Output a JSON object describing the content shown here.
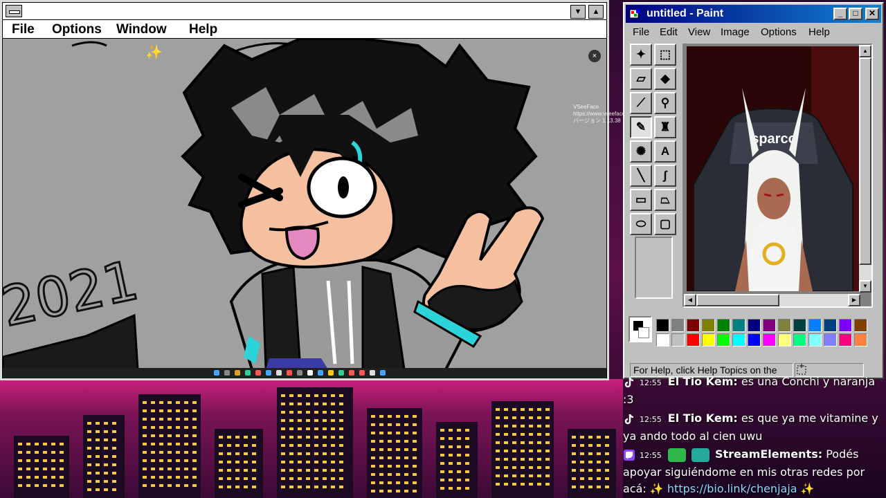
{
  "draw_app": {
    "menus": [
      "File",
      "Options",
      "Window",
      "Help"
    ],
    "drawing_text": "2021",
    "overlay": {
      "close_label": "×",
      "vseeface_lines": [
        "VSeeFace",
        "https://www.vseeface",
        "バージョン 1.13.38"
      ]
    }
  },
  "paint": {
    "title": "untitled - Paint",
    "menus": [
      "File",
      "Edit",
      "View",
      "Image",
      "Options",
      "Help"
    ],
    "status": "For Help, click Help Topics on the",
    "tools": [
      {
        "name": "free-form-select",
        "glyph": "✦"
      },
      {
        "name": "select",
        "glyph": "⬚"
      },
      {
        "name": "eraser",
        "glyph": "▱"
      },
      {
        "name": "fill",
        "glyph": "◆"
      },
      {
        "name": "pick-color",
        "glyph": "⟋"
      },
      {
        "name": "magnifier",
        "glyph": "⚲"
      },
      {
        "name": "pencil",
        "glyph": "✎"
      },
      {
        "name": "brush",
        "glyph": "♜"
      },
      {
        "name": "airbrush",
        "glyph": "✺"
      },
      {
        "name": "text",
        "glyph": "A"
      },
      {
        "name": "line",
        "glyph": "╲"
      },
      {
        "name": "curve",
        "glyph": "∫"
      },
      {
        "name": "rectangle",
        "glyph": "▭"
      },
      {
        "name": "polygon",
        "glyph": "⏢"
      },
      {
        "name": "ellipse",
        "glyph": "⬭"
      },
      {
        "name": "rounded-rectangle",
        "glyph": "▢"
      }
    ],
    "active_tool": "pencil",
    "palette_top": [
      "#000000",
      "#808080",
      "#800000",
      "#808000",
      "#008000",
      "#008080",
      "#000080",
      "#800080",
      "#808040",
      "#004040",
      "#0080ff",
      "#004080",
      "#8000ff",
      "#804000"
    ],
    "palette_bottom": [
      "#ffffff",
      "#c0c0c0",
      "#ff0000",
      "#ffff00",
      "#00ff00",
      "#00ffff",
      "#0000ff",
      "#ff00ff",
      "#ffff80",
      "#00ff80",
      "#80ffff",
      "#8080ff",
      "#ff0080",
      "#ff8040"
    ],
    "chair_brand": "sparco"
  },
  "chat": [
    {
      "time": "12:55",
      "user": "El Tio Kem:",
      "text": "es una Conchi y naranja :3",
      "platform": "tiktok"
    },
    {
      "time": "12:55",
      "user": "El Tio Kem:",
      "text": "es que ya me vitamine y ya ando todo al cien uwu",
      "platform": "tiktok"
    },
    {
      "time": "12:55",
      "user": "StreamElements:",
      "text": "Podés apoyar siguiéndome en mis otras redes por acá: ✨",
      "link": "https://bio.link/chenjaja",
      "after_link": "✨",
      "platform": "twitch"
    }
  ]
}
